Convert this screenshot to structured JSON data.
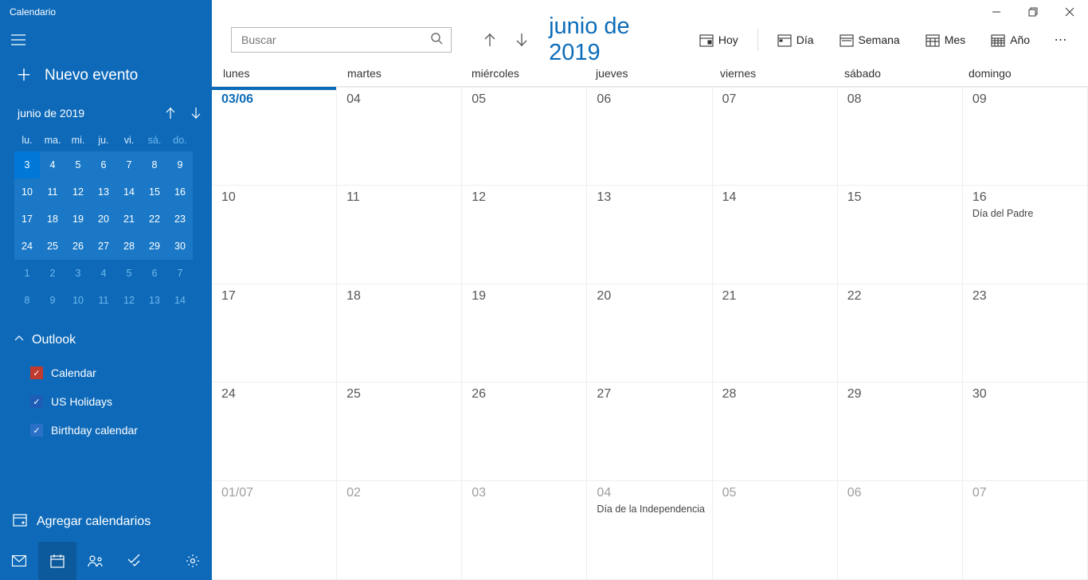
{
  "app": {
    "title": "Calendario"
  },
  "sidebar": {
    "new_event": "Nuevo evento",
    "mini": {
      "label": "junio de 2019",
      "dow": [
        "lu.",
        "ma.",
        "mi.",
        "ju.",
        "vi.",
        "sá.",
        "do."
      ],
      "weekend_idx": [
        5,
        6
      ],
      "rows": [
        [
          {
            "n": "3",
            "today": true
          },
          {
            "n": "4"
          },
          {
            "n": "5"
          },
          {
            "n": "6"
          },
          {
            "n": "7"
          },
          {
            "n": "8"
          },
          {
            "n": "9"
          }
        ],
        [
          {
            "n": "10"
          },
          {
            "n": "11"
          },
          {
            "n": "12"
          },
          {
            "n": "13"
          },
          {
            "n": "14"
          },
          {
            "n": "15"
          },
          {
            "n": "16"
          }
        ],
        [
          {
            "n": "17"
          },
          {
            "n": "18"
          },
          {
            "n": "19"
          },
          {
            "n": "20"
          },
          {
            "n": "21"
          },
          {
            "n": "22"
          },
          {
            "n": "23"
          }
        ],
        [
          {
            "n": "24"
          },
          {
            "n": "25"
          },
          {
            "n": "26"
          },
          {
            "n": "27"
          },
          {
            "n": "28"
          },
          {
            "n": "29"
          },
          {
            "n": "30"
          }
        ],
        [
          {
            "n": "1",
            "next": true
          },
          {
            "n": "2",
            "next": true
          },
          {
            "n": "3",
            "next": true
          },
          {
            "n": "4",
            "next": true
          },
          {
            "n": "5",
            "next": true
          },
          {
            "n": "6",
            "next": true
          },
          {
            "n": "7",
            "next": true
          }
        ],
        [
          {
            "n": "8",
            "next": true
          },
          {
            "n": "9",
            "next": true
          },
          {
            "n": "10",
            "next": true
          },
          {
            "n": "11",
            "next": true
          },
          {
            "n": "12",
            "next": true
          },
          {
            "n": "13",
            "next": true
          },
          {
            "n": "14",
            "next": true
          }
        ]
      ]
    },
    "section": "Outlook",
    "calendars": [
      {
        "label": "Calendar",
        "color": "red"
      },
      {
        "label": "US Holidays",
        "color": "blue1"
      },
      {
        "label": "Birthday calendar",
        "color": "blue2"
      }
    ],
    "add_cal": "Agregar calendarios"
  },
  "toolbar": {
    "search_placeholder": "Buscar",
    "month_title": "junio de 2019",
    "today": "Hoy",
    "day": "Día",
    "week": "Semana",
    "month": "Mes",
    "year": "Año"
  },
  "dow_full": [
    "lunes",
    "martes",
    "miércoles",
    "jueves",
    "viernes",
    "sábado",
    "domingo"
  ],
  "grid": [
    [
      {
        "d": "03/06",
        "today": true
      },
      {
        "d": "04"
      },
      {
        "d": "05"
      },
      {
        "d": "06"
      },
      {
        "d": "07"
      },
      {
        "d": "08"
      },
      {
        "d": "09"
      }
    ],
    [
      {
        "d": "10"
      },
      {
        "d": "11"
      },
      {
        "d": "12"
      },
      {
        "d": "13"
      },
      {
        "d": "14"
      },
      {
        "d": "15"
      },
      {
        "d": "16",
        "ev": "Día del Padre"
      }
    ],
    [
      {
        "d": "17"
      },
      {
        "d": "18"
      },
      {
        "d": "19"
      },
      {
        "d": "20"
      },
      {
        "d": "21"
      },
      {
        "d": "22"
      },
      {
        "d": "23"
      }
    ],
    [
      {
        "d": "24"
      },
      {
        "d": "25"
      },
      {
        "d": "26"
      },
      {
        "d": "27"
      },
      {
        "d": "28"
      },
      {
        "d": "29"
      },
      {
        "d": "30"
      }
    ],
    [
      {
        "d": "01/07",
        "other": true
      },
      {
        "d": "02",
        "other": true
      },
      {
        "d": "03",
        "other": true
      },
      {
        "d": "04",
        "other": true,
        "ev": "Día de la Independencia"
      },
      {
        "d": "05",
        "other": true
      },
      {
        "d": "06",
        "other": true
      },
      {
        "d": "07",
        "other": true
      }
    ]
  ]
}
